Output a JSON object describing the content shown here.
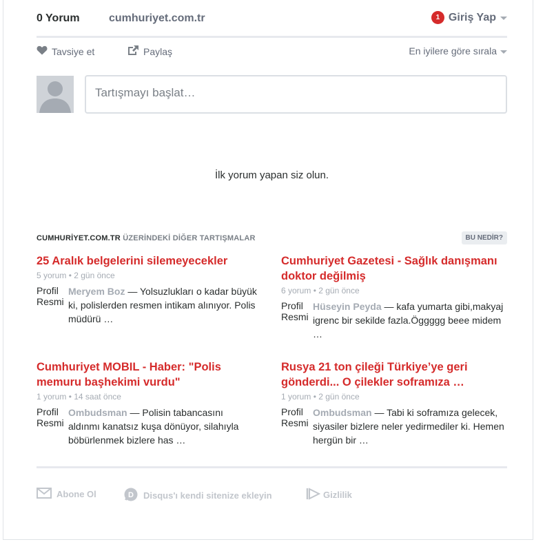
{
  "nav": {
    "comment_count": "0 Yorum",
    "site": "cumhuriyet.com.tr",
    "notification_count": "1",
    "login": "Giriş Yap"
  },
  "actions": {
    "recommend": "Tavsiye et",
    "share": "Paylaş",
    "sort": "En iyilere göre sırala"
  },
  "composer": {
    "placeholder": "Tartışmayı başlat…"
  },
  "empty_message": "İlk yorum yapan siz olun.",
  "other": {
    "site": "CUMHURİYET.COM.TR",
    "rest": "ÜZERİNDEKİ DİĞER TARTIŞMALAR",
    "whatis": "BU NEDİR?",
    "cards": [
      {
        "title": "25 Aralık belgelerini silemeyecekler",
        "comments": "5 yorum",
        "time": "2 gün önce",
        "profile_line1": "Profil",
        "profile_line2": "Resmi",
        "author": "Meryem Boz",
        "text": "— Yolsuzlukları o kadar büyük ki, polislerden resmen intikam alınıyor. Polis müdürü …"
      },
      {
        "title": "Cumhuriyet Gazetesi - Sağlık danışmanı doktor değilmiş",
        "comments": "6 yorum",
        "time": "2 gün önce",
        "profile_line1": "Profil",
        "profile_line2": "Resmi",
        "author": "Hüseyin Peyda",
        "text": "— kafa yumarta gibi,makyaj igrenc bir sekilde fazla.Öggggg beee midem …"
      },
      {
        "title": "Cumhuriyet MOBIL - Haber: \"Polis memuru başhekimi vurdu\"",
        "comments": "1 yorum",
        "time": "14 saat önce",
        "profile_line1": "Profil",
        "profile_line2": "Resmi",
        "author": "Ombudsman",
        "text": "— Polisin tabancasını aldınmı kanatsız kuşa dönüyor, silahıyla böbürlenmek bizlere has …"
      },
      {
        "title": "Rusya 21 ton çileği Türkiye’ye geri gönderdi... O çilekler soframıza …",
        "comments": "1 yorum",
        "time": "2 gün önce",
        "profile_line1": "Profil",
        "profile_line2": "Resmi",
        "author": "Ombudsman",
        "text": "— Tabi ki soframıza gelecek, siyasiler bizlere neler yedirmediler ki. Hemen hergün bir …"
      }
    ]
  },
  "footer": {
    "subscribe": "Abone Ol",
    "add_disqus": "Disqus'ı kendi sitenize ekleyin",
    "privacy": "Gizlilik"
  },
  "colors": {
    "accent": "#d52b2b",
    "muted": "#656c7a",
    "light": "#a5abb3"
  },
  "icons": [
    "heart-icon",
    "share-icon",
    "chevron-down-icon",
    "default-avatar-icon",
    "envelope-icon",
    "disqus-icon",
    "privacy-icon"
  ]
}
